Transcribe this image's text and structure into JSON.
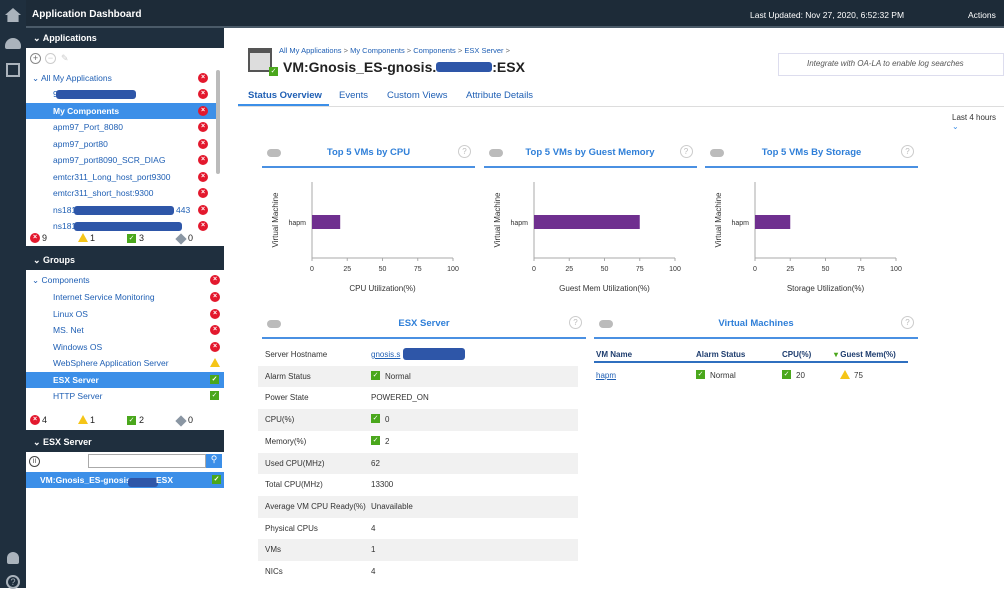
{
  "header": {
    "title": "Application Dashboard",
    "last_updated": "Last Updated: Nov 27, 2020, 6:52:32 PM",
    "actions": "Actions"
  },
  "rail": [
    "home-icon",
    "dashboard-icon",
    "settings-sliders-icon",
    "user-icon",
    "help-icon"
  ],
  "applications": {
    "title": "Applications",
    "root": "All My Applications",
    "items": [
      {
        "label": "9"
      },
      {
        "label": "My Components",
        "selected": true
      },
      {
        "label": "apm97_Port_8080"
      },
      {
        "label": "apm97_port80"
      },
      {
        "label": "apm97_port8090_SCR_DIAG"
      },
      {
        "label": "emtcr311_Long_host_port9300"
      },
      {
        "label": "emtcr311_short_host:9300"
      },
      {
        "label": "ns181.",
        "suffix": "443"
      },
      {
        "label": "ns181."
      }
    ],
    "counts": {
      "critical": "9",
      "warning": "1",
      "normal": "3",
      "unknown": "0"
    }
  },
  "groups": {
    "title": "Groups",
    "root": "Components",
    "items": [
      {
        "label": "Internet Service Monitoring",
        "status": "critical"
      },
      {
        "label": "Linux OS",
        "status": "critical"
      },
      {
        "label": "MS. Net",
        "status": "critical"
      },
      {
        "label": "Windows OS",
        "status": "critical"
      },
      {
        "label": "WebSphere Application Server",
        "status": "warning"
      },
      {
        "label": "ESX Server",
        "status": "normal",
        "selected": true
      },
      {
        "label": "HTTP Server",
        "status": "normal"
      }
    ],
    "counts": {
      "critical": "4",
      "warning": "1",
      "normal": "2",
      "unknown": "0"
    }
  },
  "esx_panel": {
    "title": "ESX Server",
    "search_placeholder": "",
    "item": "VM:Gnosis_ES-gnosis.s",
    "item_suffix": "ESX"
  },
  "main": {
    "breadcrumb": [
      "All My Applications",
      "My Components",
      "Components",
      "ESX Server"
    ],
    "title_prefix": "VM:Gnosis_ES-gnosis.",
    "title_suffix": ":ESX",
    "oala": "Integrate with OA-LA to enable log searches",
    "tabs": [
      "Status Overview",
      "Events",
      "Custom Views",
      "Attribute Details"
    ],
    "active_tab": 0,
    "time_range": "Last 4 hours"
  },
  "chart_data": [
    {
      "type": "bar",
      "title": "Top 5 VMs by CPU",
      "ylabel": "Virtual Machine",
      "xlabel": "CPU Utilization(%)",
      "categories": [
        "hapm"
      ],
      "values": [
        20
      ],
      "xlim": [
        0,
        100
      ],
      "ticks": [
        "0",
        "25",
        "50",
        "75",
        "100"
      ],
      "color": "#6f2f8f"
    },
    {
      "type": "bar",
      "title": "Top 5 VMs by Guest Memory",
      "ylabel": "Virtual Machine",
      "xlabel": "Guest Mem Utilization(%)",
      "categories": [
        "hapm"
      ],
      "values": [
        75
      ],
      "xlim": [
        0,
        100
      ],
      "ticks": [
        "0",
        "25",
        "50",
        "75",
        "100"
      ],
      "color": "#6f2f8f"
    },
    {
      "type": "bar",
      "title": "Top 5 VMs By Storage",
      "ylabel": "Virtual Machine",
      "xlabel": "Storage Utilization(%)",
      "categories": [
        "hapm"
      ],
      "values": [
        25
      ],
      "xlim": [
        0,
        100
      ],
      "ticks": [
        "0",
        "25",
        "50",
        "75",
        "100"
      ],
      "color": "#6f2f8f"
    }
  ],
  "esx": {
    "title": "ESX Server",
    "rows": [
      {
        "label": "Server Hostname",
        "value": "gnosis.s",
        "link": true
      },
      {
        "label": "Alarm Status",
        "value": "Normal",
        "status": "normal"
      },
      {
        "label": "Power State",
        "value": "POWERED_ON"
      },
      {
        "label": "CPU(%)",
        "value": "0",
        "status": "normal"
      },
      {
        "label": "Memory(%)",
        "value": "2",
        "status": "normal"
      },
      {
        "label": "Used CPU(MHz)",
        "value": "62"
      },
      {
        "label": "Total CPU(MHz)",
        "value": "13300"
      },
      {
        "label": "Average VM CPU Ready(%)",
        "value": "Unavailable"
      },
      {
        "label": "Physical CPUs",
        "value": "4"
      },
      {
        "label": "VMs",
        "value": "1"
      },
      {
        "label": "NICs",
        "value": "4"
      }
    ]
  },
  "vms": {
    "title": "Virtual Machines",
    "columns": [
      "VM Name",
      "Alarm Status",
      "CPU(%)",
      "Guest Mem(%)"
    ],
    "sort_column": 3,
    "rows": [
      {
        "name": "hapm",
        "alarm": "Normal",
        "cpu": "20",
        "mem": "75"
      }
    ]
  }
}
